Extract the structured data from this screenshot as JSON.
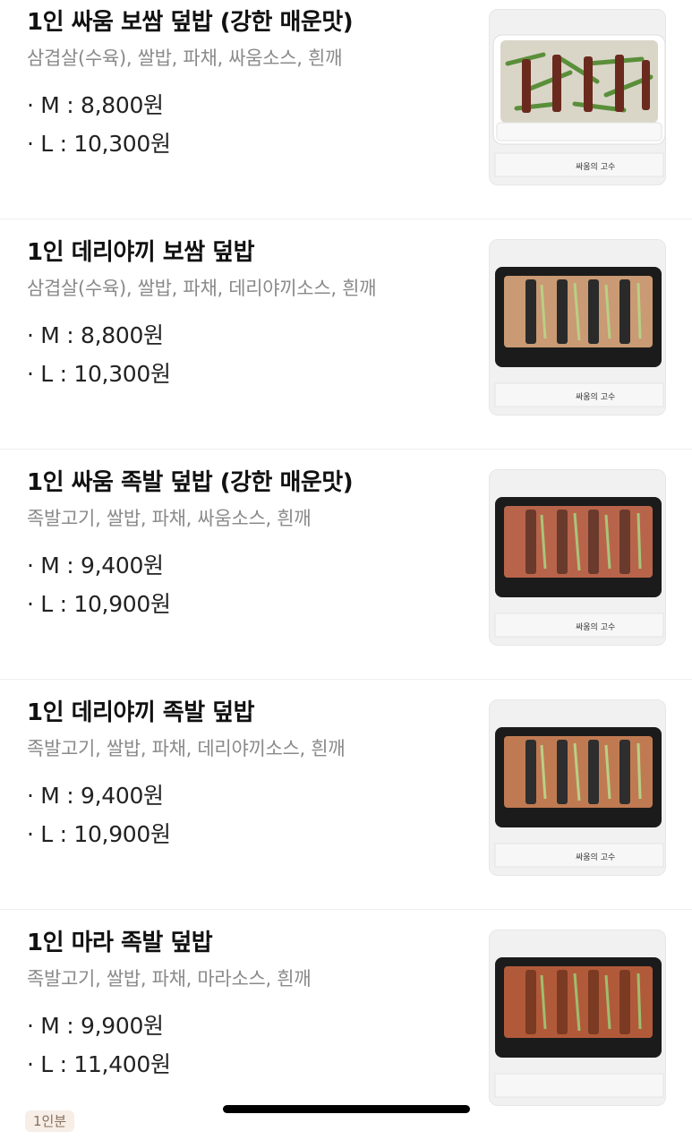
{
  "colors": {
    "title": "#111111",
    "description": "#8a8a8a",
    "divider": "#eeeeee",
    "badge_bg": "#f6eee7",
    "badge_text": "#8b6f5b"
  },
  "menu": [
    {
      "name": "1인 싸움 보쌈 덮밥 (강한 매운맛)",
      "description": "삼겹살(수육), 쌀밥, 파채, 싸움소스, 흰깨",
      "price_m": "· M : 8,800원",
      "price_l": "· L : 10,300원",
      "image": "bossam-spicy-bowl-white-container"
    },
    {
      "name": "1인 데리야끼 보쌈 덮밥",
      "description": "삼겹살(수육), 쌀밥, 파채, 데리야끼소스, 흰깨",
      "price_m": "· M : 8,800원",
      "price_l": "· L : 10,300원",
      "image": "bossam-teriyaki-bowl-black-container"
    },
    {
      "name": "1인 싸움 족발 덮밥 (강한 매운맛)",
      "description": "족발고기, 쌀밥, 파채, 싸움소스, 흰깨",
      "price_m": "· M : 9,400원",
      "price_l": "· L : 10,900원",
      "image": "jokbal-spicy-bowl-black-container"
    },
    {
      "name": "1인 데리야끼 족발 덮밥",
      "description": "족발고기, 쌀밥, 파채, 데리야끼소스, 흰깨",
      "price_m": "· M : 9,400원",
      "price_l": "· L : 10,900원",
      "image": "jokbal-teriyaki-bowl-black-container"
    },
    {
      "name": "1인 마라 족발 덮밥",
      "description": "족발고기, 쌀밥, 파채, 마라소스, 흰깨",
      "price_m": "· M : 9,900원",
      "price_l": "· L : 11,400원",
      "image": "jokbal-mala-bowl-black-container"
    }
  ],
  "footer_badge": "1인분",
  "chopstick_label": "싸움의 고수"
}
